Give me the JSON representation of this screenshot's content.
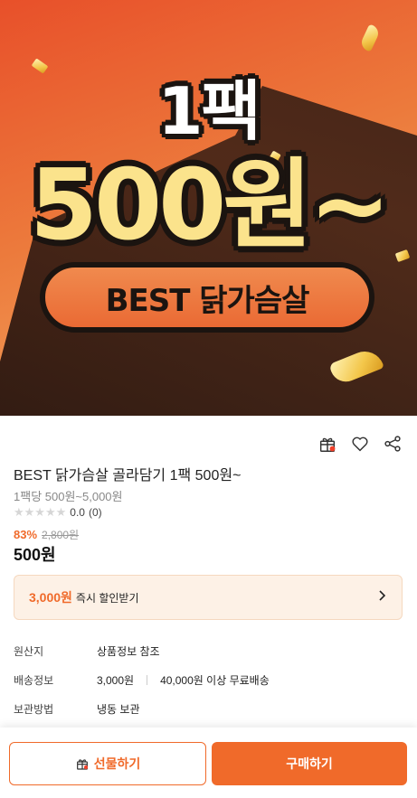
{
  "banner": {
    "line1": "1팩",
    "line2": "500원~",
    "pill": "BEST 닭가슴살"
  },
  "icons": [
    "gift-icon",
    "heart-icon",
    "share-icon"
  ],
  "product": {
    "title": "BEST 닭가슴살 골라담기 1팩 500원~",
    "subtitle": "1팩당 500원~5,000원",
    "stars": "★★★★★",
    "rating": "0.0",
    "review_count": "(0)",
    "discount": "83%",
    "original_price": "2,800원",
    "final_price": "500원"
  },
  "coupon": {
    "amount": "3,000원",
    "text": "즉시 할인받기"
  },
  "info": {
    "origin_label": "원산지",
    "origin_value": "상품정보 참조",
    "shipping_label": "배송정보",
    "shipping_fee": "3,000원",
    "shipping_free": "40,000원 이상 무료배송",
    "storage_label": "보관방법",
    "storage_value": "냉동 보관"
  },
  "actions": {
    "gift_label": "선물하기",
    "buy_label": "구매하기"
  },
  "colors": {
    "accent": "#f06a2a",
    "banner_yellow": "#fbe38c",
    "coupon_bg": "#fdf1e6"
  }
}
